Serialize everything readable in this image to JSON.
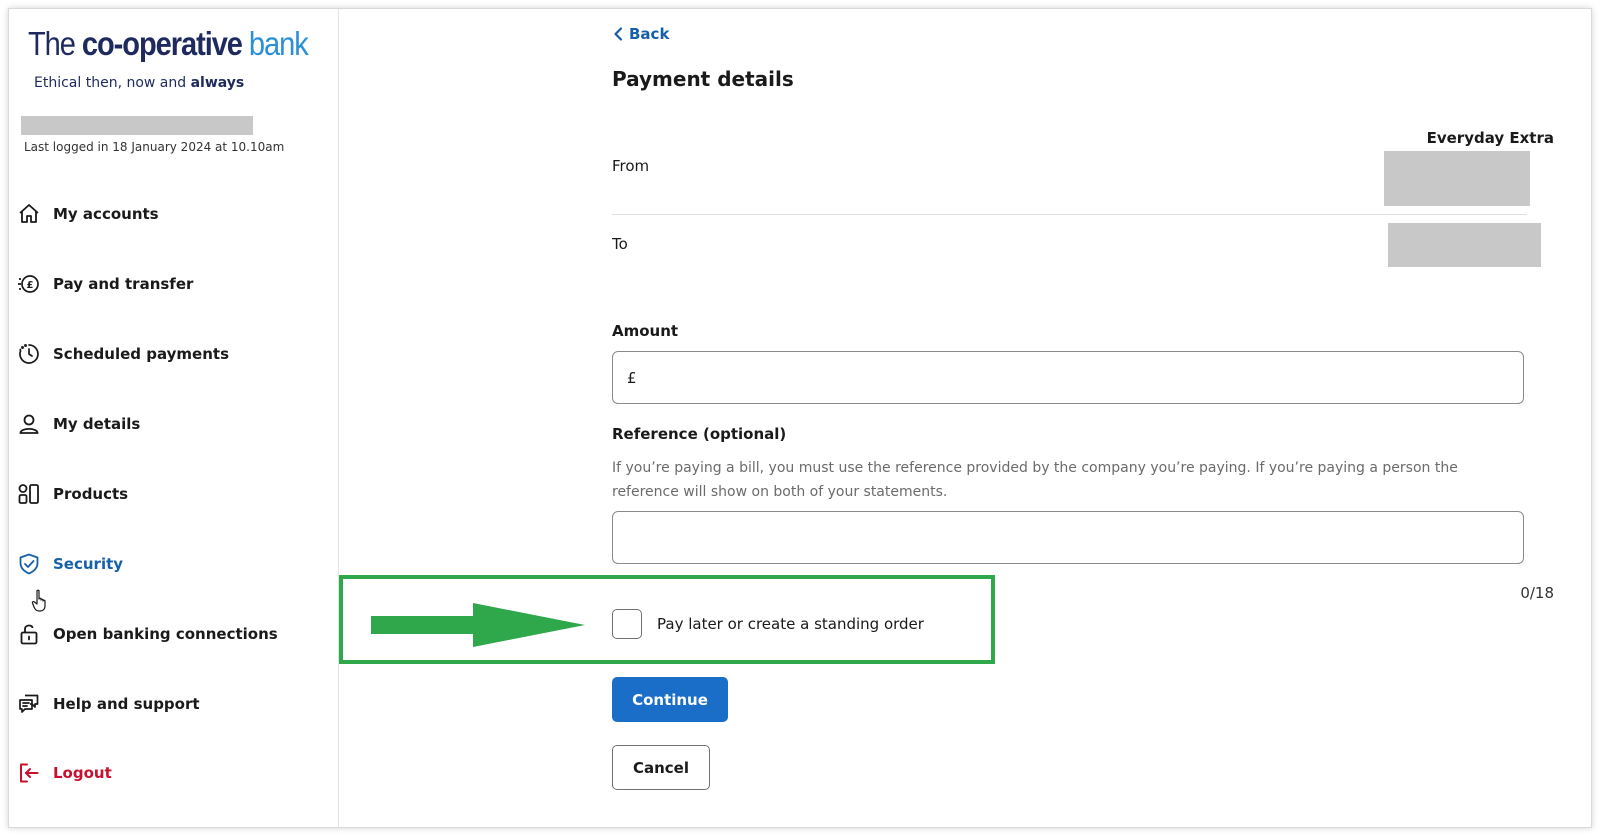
{
  "brand": {
    "logo_the": "The",
    "logo_coop": "co-operative",
    "logo_bank": "bank",
    "tagline_prefix": "Ethical then, now and",
    "tagline_bold": "always"
  },
  "user": {
    "last_logged_in": "Last logged in 18 January 2024 at 10.10am"
  },
  "sidebar": {
    "items": [
      {
        "label": "My accounts",
        "icon": "home-icon"
      },
      {
        "label": "Pay and transfer",
        "icon": "pound-transfer-icon"
      },
      {
        "label": "Scheduled payments",
        "icon": "clock-icon"
      },
      {
        "label": "My details",
        "icon": "person-icon"
      },
      {
        "label": "Products",
        "icon": "products-icon"
      },
      {
        "label": "Security",
        "icon": "shield-check-icon"
      },
      {
        "label": "Open banking connections",
        "icon": "padlock-open-icon"
      },
      {
        "label": "Help and support",
        "icon": "chat-bubbles-icon"
      },
      {
        "label": "Logout",
        "icon": "logout-icon"
      }
    ]
  },
  "main": {
    "back_label": "Back",
    "title": "Payment details",
    "from_label": "From",
    "from_account_name": "Everyday Extra",
    "to_label": "To",
    "amount": {
      "label": "Amount",
      "currency_symbol": "£",
      "value": ""
    },
    "reference": {
      "label": "Reference (optional)",
      "help_text": "If you’re paying a bill, you must use the reference provided by the company you’re paying. If you’re paying a person the reference will show on both of your statements.",
      "value": "",
      "char_count": "0/18"
    },
    "pay_later": {
      "label": "Pay later or create a standing order",
      "checked": false
    },
    "continue_label": "Continue",
    "cancel_label": "Cancel"
  },
  "colors": {
    "brand_navy": "#1e2a5e",
    "brand_blue": "#2a8fd6",
    "link_blue": "#1660a8",
    "primary_button": "#1a6ec8",
    "logout_red": "#c8102e",
    "annotation_green": "#2ea84a"
  }
}
